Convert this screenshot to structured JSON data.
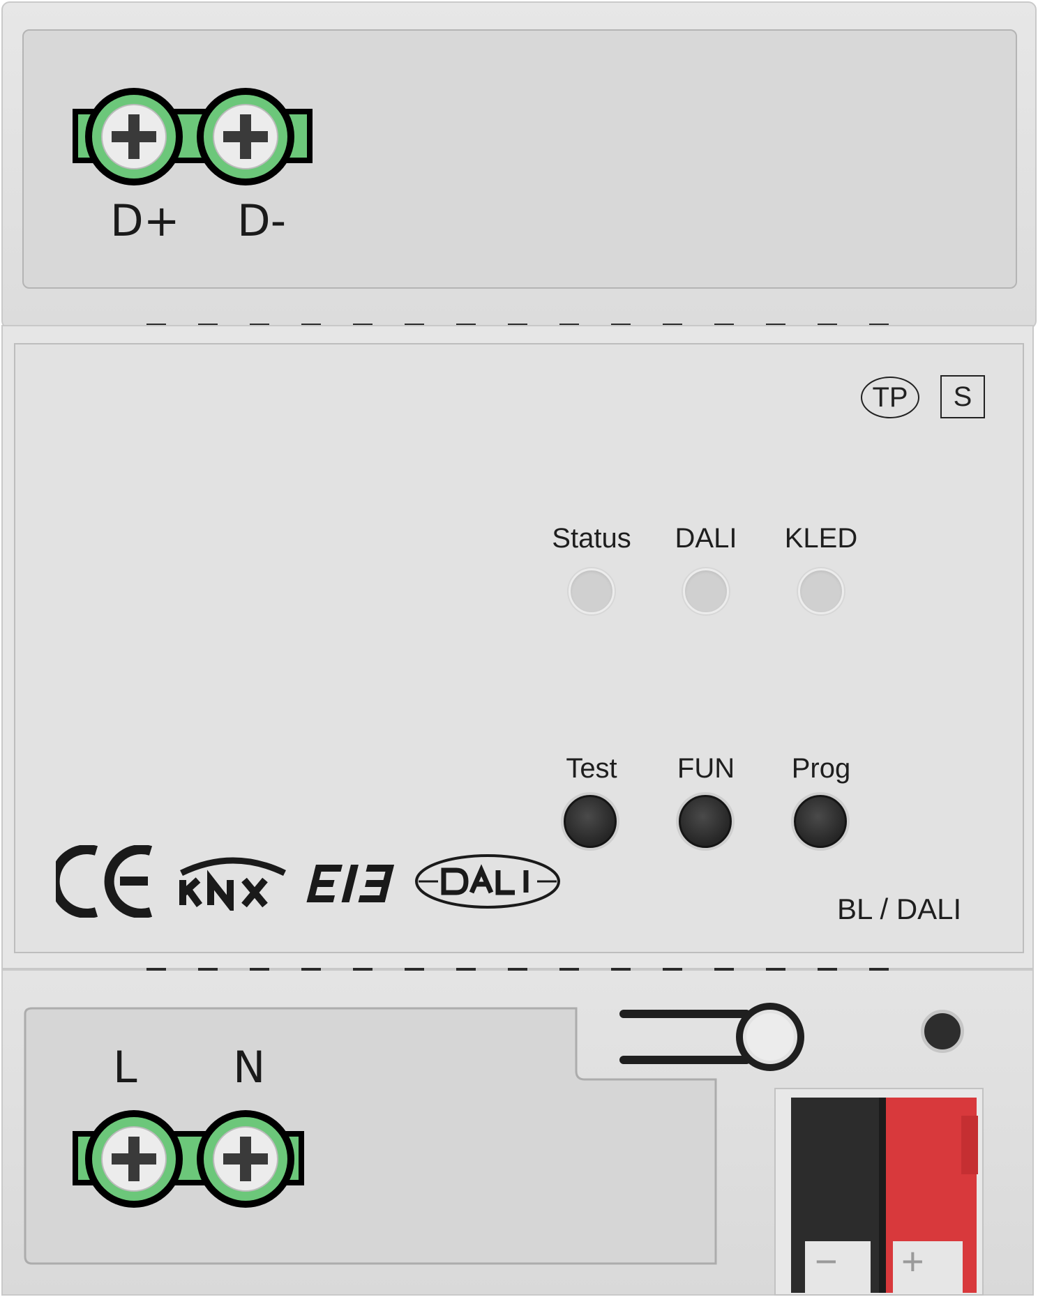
{
  "top_terminals": {
    "labels": [
      "D+",
      "D-"
    ]
  },
  "bottom_terminals": {
    "labels": [
      "L",
      "N"
    ]
  },
  "badges": {
    "tp": "TP",
    "s": "S"
  },
  "leds": [
    {
      "label": "Status"
    },
    {
      "label": "DALI"
    },
    {
      "label": "KLED"
    }
  ],
  "buttons": [
    {
      "label": "Test"
    },
    {
      "label": "FUN"
    },
    {
      "label": "Prog"
    }
  ],
  "certifications": {
    "ce": "CE",
    "knx": "KNX",
    "eib": "EIB",
    "dali": "DALI"
  },
  "model": "BL / DALI",
  "connector": {
    "minus": "−",
    "plus": "+"
  },
  "colors": {
    "terminal_green": "#6cc77a",
    "connector_black": "#2c2c2c",
    "connector_red": "#d8393c",
    "housing": "#e4e4e4"
  }
}
